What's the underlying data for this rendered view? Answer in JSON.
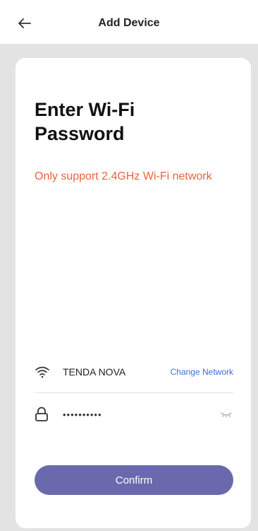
{
  "topbar": {
    "title": "Add Device",
    "back_icon": "arrow-left-icon"
  },
  "card": {
    "heading": "Enter Wi-Fi Password",
    "warning": "Only support 2.4GHz Wi-Fi network",
    "wifi": {
      "icon": "wifi-icon",
      "ssid": "TENDA NOVA",
      "change_label": "Change Network"
    },
    "password": {
      "icon": "lock-icon",
      "value": "••••••••••",
      "toggle_icon": "eye-closed-icon"
    },
    "confirm_label": "Confirm"
  },
  "colors": {
    "warning": "#e8643a",
    "link": "#3b6fd0",
    "button": "#6a69ad",
    "backdrop": "#e3e3e3"
  }
}
